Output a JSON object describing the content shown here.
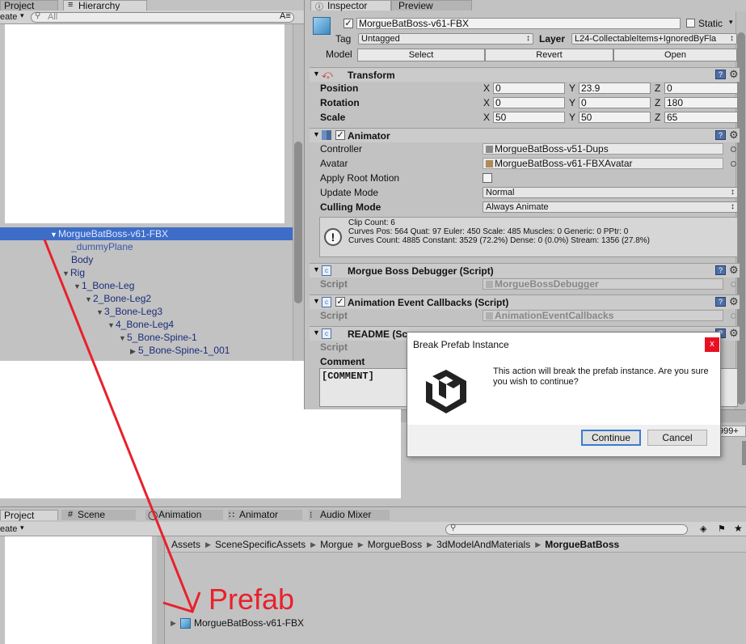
{
  "hierarchy": {
    "tab_project": "Project",
    "tab_hierarchy": "Hierarchy",
    "create_label": "eate",
    "search_placeholder": "All",
    "tree": [
      {
        "label": "MorgueBatBoss-v61-FBX",
        "selected": true
      },
      {
        "label": "_dummyPlane"
      },
      {
        "label": "Body"
      },
      {
        "label": "Rig"
      },
      {
        "label": "1_Bone-Leg"
      },
      {
        "label": "2_Bone-Leg2"
      },
      {
        "label": "3_Bone-Leg3"
      },
      {
        "label": "4_Bone-Leg4"
      },
      {
        "label": "5_Bone-Spine-1"
      },
      {
        "label": "5_Bone-Spine-1_001"
      }
    ]
  },
  "inspector": {
    "tab_inspector": "Inspector",
    "tab_preview": "Preview",
    "object_name": "MorgueBatBoss-v61-FBX",
    "static_label": "Static",
    "tag_label": "Tag",
    "tag_value": "Untagged",
    "layer_label": "Layer",
    "layer_value": "L24-CollectableItems+IgnoredByFla",
    "model_label": "Model",
    "model_buttons": [
      "Select",
      "Revert",
      "Open"
    ],
    "transform": {
      "title": "Transform",
      "position_label": "Position",
      "rotation_label": "Rotation",
      "scale_label": "Scale",
      "x": "X",
      "y": "Y",
      "z": "Z",
      "position": [
        "0",
        "23.9",
        "0"
      ],
      "rotation": [
        "0",
        "0",
        "180"
      ],
      "scale": [
        "50",
        "50",
        "65"
      ]
    },
    "animator": {
      "title": "Animator",
      "controller_label": "Controller",
      "controller_value": "MorgueBatBoss-v51-Dups",
      "avatar_label": "Avatar",
      "avatar_value": "MorgueBatBoss-v61-FBXAvatar",
      "root_motion_label": "Apply Root Motion",
      "update_mode_label": "Update Mode",
      "update_mode_value": "Normal",
      "culling_mode_label": "Culling Mode",
      "culling_mode_value": "Always Animate",
      "info_line1": "Clip Count: 6",
      "info_line2": "Curves Pos: 564 Quat: 97 Euler: 450 Scale: 485 Muscles: 0 Generic: 0 PPtr: 0",
      "info_line3": "Curves Count: 4885 Constant: 3529 (72.2%) Dense: 0 (0.0%) Stream: 1356 (27.8%)"
    },
    "debugger": {
      "title": "Morgue Boss Debugger (Script)",
      "script_label": "Script",
      "script_value": "MorgueBossDebugger"
    },
    "callbacks": {
      "title": "Animation Event Callbacks (Script)",
      "script_label": "Script",
      "script_value": "AnimationEventCallbacks"
    },
    "readme": {
      "title": "README (Sc",
      "script_label": "Script",
      "comment_label": "Comment",
      "comment_value": "[COMMENT]"
    }
  },
  "dialog": {
    "title": "Break Prefab Instance",
    "close": "x",
    "message": "This action will break the prefab instance. Are you sure you wish to continue?",
    "continue_label": "Continue",
    "cancel_label": "Cancel"
  },
  "bottom": {
    "tabs": [
      "Project",
      "Scene",
      "Animation",
      "Animator",
      "Audio Mixer"
    ],
    "create_label": "eate",
    "partial_value": "999+",
    "breadcrumb": [
      "Assets",
      "SceneSpecificAssets",
      "Morgue",
      "MorgueBoss",
      "3dModelAndMaterials",
      "MorgueBatBoss"
    ],
    "asset_name": "MorgueBatBoss-v61-FBX"
  },
  "annotation": {
    "text": "Prefab",
    "color": "#e8212b"
  }
}
